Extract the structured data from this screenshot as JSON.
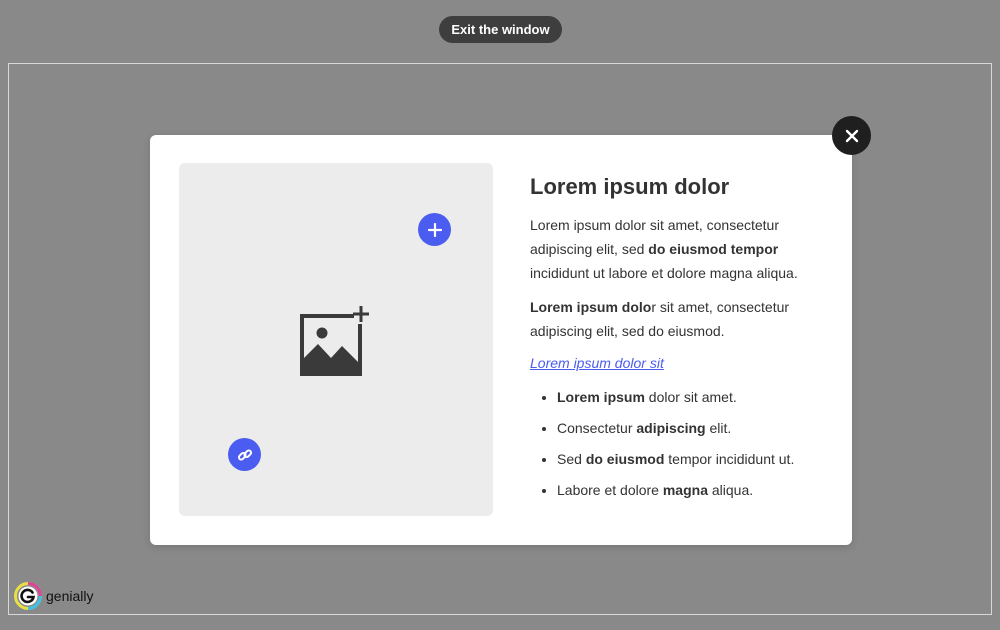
{
  "exit_button": {
    "label": "Exit the window"
  },
  "modal": {
    "title": "Lorem ipsum dolor",
    "para1": [
      {
        "text": "Lorem ipsum dolor sit amet, consectetur adipiscing elit, sed ",
        "bold": false
      },
      {
        "text": "do eiusmod tempor",
        "bold": true
      },
      {
        "text": " incididunt ut labore et dolore magna aliqua.",
        "bold": false
      }
    ],
    "para2": [
      {
        "text": "Lorem ipsum dolo",
        "bold": true
      },
      {
        "text": "r sit amet, consectetur adipiscing elit, sed do eiusmod.",
        "bold": false
      }
    ],
    "link_text": "Lorem ipsum dolor sit",
    "list": [
      [
        {
          "text": "Lorem ipsum",
          "bold": true
        },
        {
          "text": " dolor sit amet.",
          "bold": false
        }
      ],
      [
        {
          "text": "Consectetur ",
          "bold": false
        },
        {
          "text": "adipiscing",
          "bold": true
        },
        {
          "text": " elit.",
          "bold": false
        }
      ],
      [
        {
          "text": "Sed ",
          "bold": false
        },
        {
          "text": "do eiusmod",
          "bold": true
        },
        {
          "text": " tempor incididunt ut.",
          "bold": false
        }
      ],
      [
        {
          "text": "Labore et dolore ",
          "bold": false
        },
        {
          "text": "magna",
          "bold": true
        },
        {
          "text": " aliqua.",
          "bold": false
        }
      ]
    ]
  },
  "icons": {
    "close": "close-icon",
    "image_add": "image-add-icon",
    "plus": "plus-icon",
    "link": "link-icon"
  },
  "brand": {
    "name": "genially"
  },
  "colors": {
    "accent": "#4b5cf0",
    "backdrop": "#898989",
    "close_bg": "#1f1f1f",
    "pill_bg": "#3e3e3e"
  }
}
